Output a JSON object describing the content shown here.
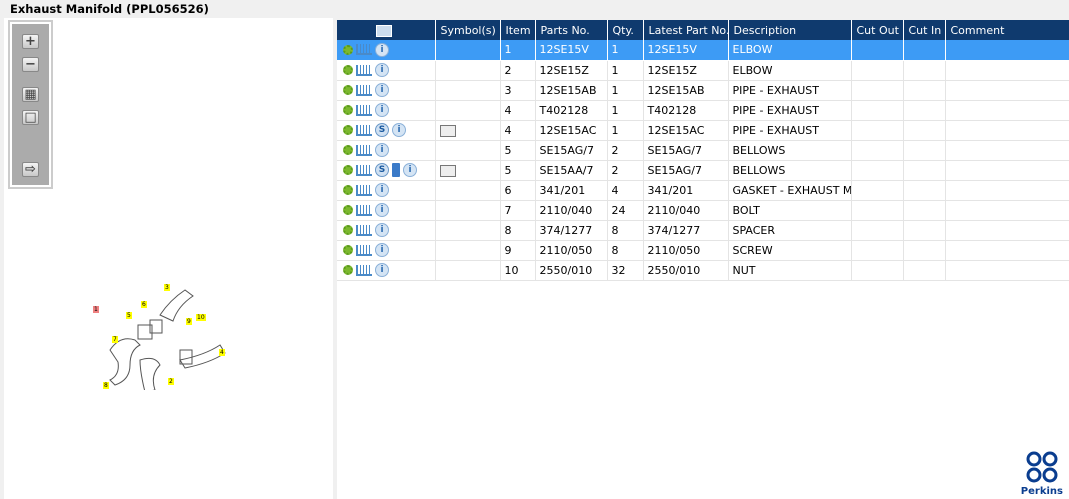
{
  "title": "Exhaust Manifold (PPL056526)",
  "toolbar": {
    "zoom_in": "+",
    "zoom_out": "−",
    "fit": "▦",
    "actual": "□",
    "toggle": "⇨"
  },
  "diagram": {
    "callouts": [
      "1",
      "2",
      "3",
      "4",
      "5",
      "6",
      "7",
      "8",
      "9",
      "10"
    ],
    "selected": "1"
  },
  "table": {
    "columns": [
      "",
      "Symbol(s)",
      "Item",
      "Parts No.",
      "Qty.",
      "Latest Part No.",
      "Description",
      "Cut Out",
      "Cut In",
      "Comment"
    ],
    "rows": [
      {
        "icons": [
          "gear",
          "cart",
          "info"
        ],
        "symbol": "",
        "item": "1",
        "part": "12SE15V",
        "qty": "1",
        "latest": "12SE15V",
        "desc": "ELBOW"
      },
      {
        "icons": [
          "gear",
          "cart",
          "info"
        ],
        "symbol": "",
        "item": "2",
        "part": "12SE15Z",
        "qty": "1",
        "latest": "12SE15Z",
        "desc": "ELBOW"
      },
      {
        "icons": [
          "gear",
          "cart",
          "info"
        ],
        "symbol": "",
        "item": "3",
        "part": "12SE15AB",
        "qty": "1",
        "latest": "12SE15AB",
        "desc": "PIPE - EXHAUST"
      },
      {
        "icons": [
          "gear",
          "cart",
          "info"
        ],
        "symbol": "",
        "item": "4",
        "part": "T402128",
        "qty": "1",
        "latest": "T402128",
        "desc": "PIPE - EXHAUST"
      },
      {
        "icons": [
          "gear",
          "cart",
          "s",
          "info"
        ],
        "symbol": "book-search",
        "item": "4",
        "part": "12SE15AC",
        "qty": "1",
        "latest": "12SE15AC",
        "desc": "PIPE - EXHAUST"
      },
      {
        "icons": [
          "gear",
          "cart",
          "info"
        ],
        "symbol": "",
        "item": "5",
        "part": "SE15AG/7",
        "qty": "2",
        "latest": "SE15AG/7",
        "desc": "BELLOWS"
      },
      {
        "icons": [
          "gear",
          "cart",
          "s",
          "book",
          "info"
        ],
        "symbol": "book-search",
        "item": "5",
        "part": "SE15AA/7",
        "qty": "2",
        "latest": "SE15AG/7",
        "desc": "BELLOWS"
      },
      {
        "icons": [
          "gear",
          "cart",
          "info"
        ],
        "symbol": "",
        "item": "6",
        "part": "341/201",
        "qty": "4",
        "latest": "341/201",
        "desc": "GASKET - EXHAUST MANIFOLD"
      },
      {
        "icons": [
          "gear",
          "cart",
          "info"
        ],
        "symbol": "",
        "item": "7",
        "part": "2110/040",
        "qty": "24",
        "latest": "2110/040",
        "desc": "BOLT"
      },
      {
        "icons": [
          "gear",
          "cart",
          "info"
        ],
        "symbol": "",
        "item": "8",
        "part": "374/1277",
        "qty": "8",
        "latest": "374/1277",
        "desc": "SPACER"
      },
      {
        "icons": [
          "gear",
          "cart",
          "info"
        ],
        "symbol": "",
        "item": "9",
        "part": "2110/050",
        "qty": "8",
        "latest": "2110/050",
        "desc": "SCREW"
      },
      {
        "icons": [
          "gear",
          "cart",
          "info"
        ],
        "symbol": "",
        "item": "10",
        "part": "2550/010",
        "qty": "32",
        "latest": "2550/010",
        "desc": "NUT"
      }
    ]
  },
  "logo": "Perkins",
  "colors": {
    "header": "#0f3a6e",
    "selected": "#3d9bf5",
    "callout": "#ffff00"
  }
}
